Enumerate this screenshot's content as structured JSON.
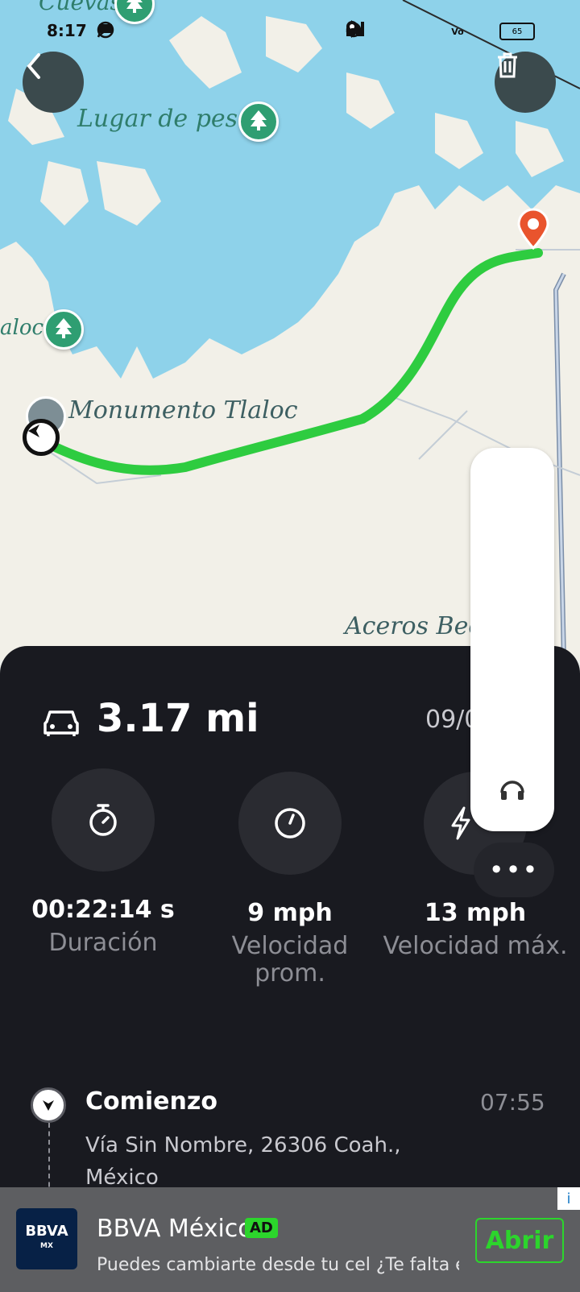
{
  "status_bar": {
    "time": "8:17",
    "battery": "65"
  },
  "map": {
    "labels": {
      "cuevas": "Cuevas",
      "lugar_de_pesca": "Lugar de pesca",
      "tlaloc_left": "aloc",
      "monumento": "Monumento Tlaloc",
      "aceros": "Aceros Beck"
    }
  },
  "trip": {
    "distance": "3.17 mi",
    "date": "09/0",
    "stats": [
      {
        "value": "00:22:14 s",
        "label": "Duración",
        "icon": "stopwatch-icon"
      },
      {
        "value": "9 mph",
        "label": "Velocidad prom.",
        "icon": "gauge-icon"
      },
      {
        "value": "13 mph",
        "label": "Velocidad máx.",
        "icon": "lightning-icon"
      }
    ],
    "start": {
      "title": "Comienzo",
      "time": "07:55",
      "address": "Vía Sin Nombre, 26306 Coah., México"
    },
    "more_label": "•••"
  },
  "ad": {
    "logo_text": "BBVA",
    "logo_sub": "MX",
    "title": "BBVA México",
    "badge": "AD",
    "subtitle": "Puedes cambiarte desde tu cel ¿Te falta e...",
    "cta": "Abrir",
    "info": "i"
  },
  "colors": {
    "route": "#2ecc40",
    "water": "#8ed2ea",
    "land": "#f2f0e8",
    "panel": "#191a20",
    "ad_green": "#2cd52c"
  }
}
